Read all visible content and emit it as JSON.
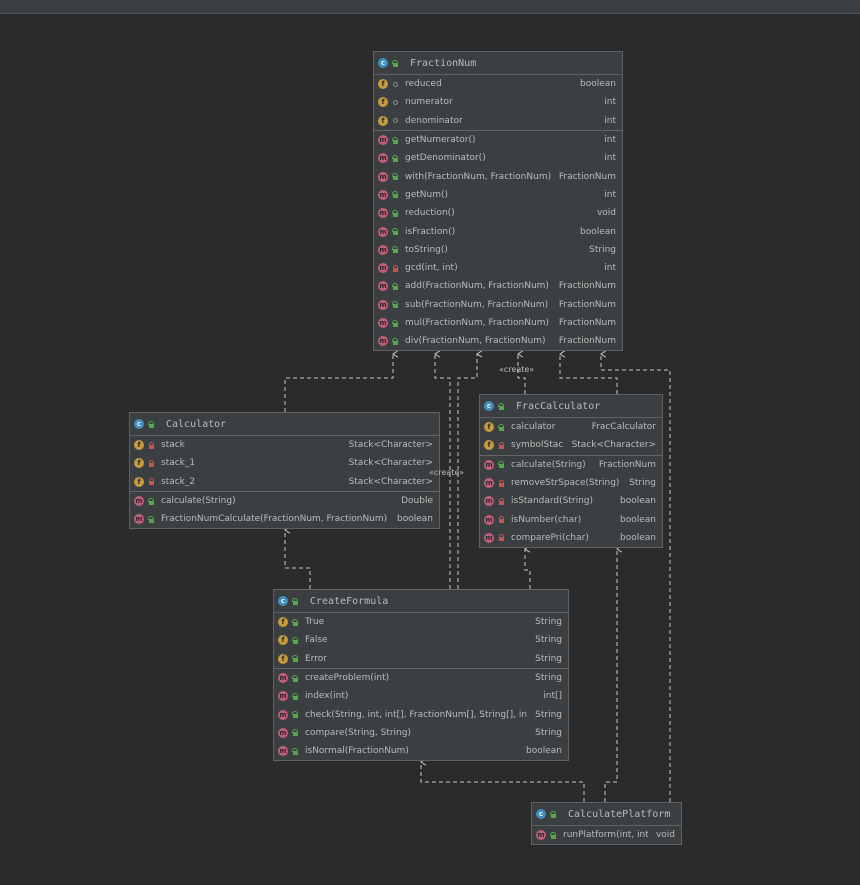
{
  "colors": {
    "background": "#2b2b2b",
    "box": "#3c3f41",
    "border": "#5f6264",
    "edge": "#c7c7c7"
  },
  "labels": {
    "create1": "«create»",
    "create2": "«create»"
  },
  "classes": {
    "FractionNum": {
      "name": "FractionNum",
      "fields": [
        {
          "name": "reduced",
          "type": "boolean",
          "icon": "f",
          "vis": "pkg"
        },
        {
          "name": "numerator",
          "type": "int",
          "icon": "f",
          "vis": "pkg"
        },
        {
          "name": "denominator",
          "type": "int",
          "icon": "f",
          "vis": "pkg"
        }
      ],
      "methods": [
        {
          "name": "getNumerator()",
          "type": "int",
          "vis": "pub"
        },
        {
          "name": "getDenominator()",
          "type": "int",
          "vis": "pub"
        },
        {
          "name": "with(FractionNum, FractionNum)",
          "type": "FractionNum",
          "vis": "pub"
        },
        {
          "name": "getNum()",
          "type": "int",
          "vis": "pub"
        },
        {
          "name": "reduction()",
          "type": "void",
          "vis": "pub"
        },
        {
          "name": "isFraction()",
          "type": "boolean",
          "vis": "pub"
        },
        {
          "name": "toString()",
          "type": "String",
          "vis": "pub"
        },
        {
          "name": "gcd(int, int)",
          "type": "int",
          "vis": "priv"
        },
        {
          "name": "add(FractionNum, FractionNum)",
          "type": "FractionNum",
          "vis": "pub"
        },
        {
          "name": "sub(FractionNum, FractionNum)",
          "type": "FractionNum",
          "vis": "pub"
        },
        {
          "name": "mul(FractionNum, FractionNum)",
          "type": "FractionNum",
          "vis": "pub"
        },
        {
          "name": "div(FractionNum, FractionNum)",
          "type": "FractionNum",
          "vis": "pub"
        }
      ]
    },
    "Calculator": {
      "name": "Calculator",
      "fields": [
        {
          "name": "stack",
          "type": "Stack<Character>",
          "icon": "f",
          "vis": "priv"
        },
        {
          "name": "stack_1",
          "type": "Stack<Character>",
          "icon": "f",
          "vis": "priv"
        },
        {
          "name": "stack_2",
          "type": "Stack<Character>",
          "icon": "f",
          "vis": "priv"
        }
      ],
      "methods": [
        {
          "name": "calculate(String)",
          "type": "Double",
          "vis": "pub"
        },
        {
          "name": "FractionNumCalculate(FractionNum, FractionNum)",
          "type": "boolean",
          "vis": "pub"
        }
      ]
    },
    "FracCalculator": {
      "name": "FracCalculator",
      "fields": [
        {
          "name": "calculator",
          "type": "FracCalculator",
          "icon": "f",
          "vis": "pub"
        },
        {
          "name": "symbolStack",
          "type": "Stack<Character>",
          "icon": "f",
          "vis": "priv"
        }
      ],
      "methods": [
        {
          "name": "calculate(String)",
          "type": "FractionNum",
          "vis": "pub"
        },
        {
          "name": "removeStrSpace(String)",
          "type": "String",
          "vis": "priv"
        },
        {
          "name": "isStandard(String)",
          "type": "boolean",
          "vis": "priv"
        },
        {
          "name": "isNumber(char)",
          "type": "boolean",
          "vis": "priv"
        },
        {
          "name": "comparePri(char)",
          "type": "boolean",
          "vis": "priv"
        }
      ]
    },
    "CreateFormula": {
      "name": "CreateFormula",
      "fields": [
        {
          "name": "True",
          "type": "String",
          "icon": "f",
          "vis": "pub"
        },
        {
          "name": "False",
          "type": "String",
          "icon": "f",
          "vis": "pub"
        },
        {
          "name": "Error",
          "type": "String",
          "icon": "f",
          "vis": "pub"
        }
      ],
      "methods": [
        {
          "name": "createProblem(int)",
          "type": "String",
          "vis": "pub"
        },
        {
          "name": "index(int)",
          "type": "int[]",
          "vis": "pub"
        },
        {
          "name": "check(String, int, int[], FractionNum[], String[], int)",
          "type": "String",
          "vis": "pub"
        },
        {
          "name": "compare(String, String)",
          "type": "String",
          "vis": "pub"
        },
        {
          "name": "isNormal(FractionNum)",
          "type": "boolean",
          "vis": "pub"
        }
      ]
    },
    "CalculatePlatform": {
      "name": "CalculatePlatform",
      "fields": [],
      "methods": [
        {
          "name": "runPlatform(int, int)",
          "type": "void",
          "vis": "pub"
        }
      ]
    }
  }
}
